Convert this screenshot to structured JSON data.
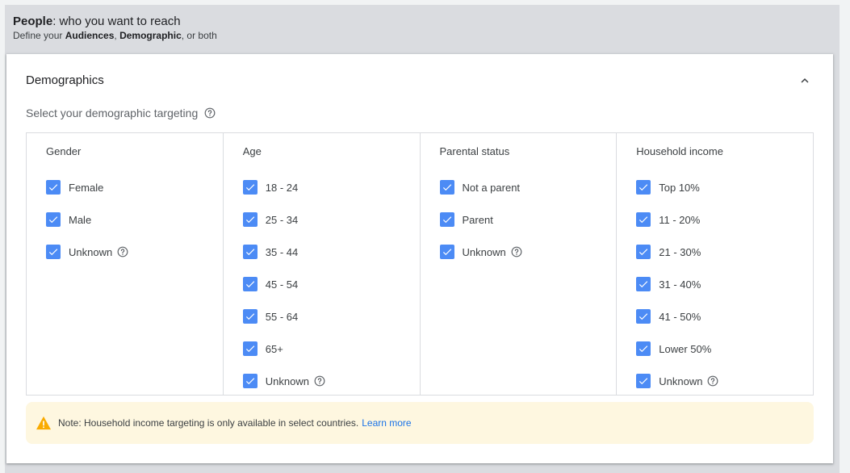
{
  "header": {
    "title_bold": "People",
    "title_rest": ": who you want to reach",
    "subtitle_prefix": "Define your ",
    "subtitle_bold1": "Audiences",
    "subtitle_sep": ", ",
    "subtitle_bold2": "Demographic",
    "subtitle_suffix": ", or both"
  },
  "card": {
    "title": "Demographics",
    "collapse_icon": "chevron-up-icon",
    "instruction": "Select your demographic targeting",
    "help_icon": "help-circle-icon"
  },
  "columns": [
    {
      "header": "Gender",
      "items": [
        {
          "label": "Female",
          "checked": true,
          "help": false
        },
        {
          "label": "Male",
          "checked": true,
          "help": false
        },
        {
          "label": "Unknown",
          "checked": true,
          "help": true
        }
      ]
    },
    {
      "header": "Age",
      "items": [
        {
          "label": "18 - 24",
          "checked": true,
          "help": false
        },
        {
          "label": "25 - 34",
          "checked": true,
          "help": false
        },
        {
          "label": "35 - 44",
          "checked": true,
          "help": false
        },
        {
          "label": "45 - 54",
          "checked": true,
          "help": false
        },
        {
          "label": "55 - 64",
          "checked": true,
          "help": false
        },
        {
          "label": "65+",
          "checked": true,
          "help": false
        },
        {
          "label": "Unknown",
          "checked": true,
          "help": true
        }
      ]
    },
    {
      "header": "Parental status",
      "items": [
        {
          "label": "Not a parent",
          "checked": true,
          "help": false
        },
        {
          "label": "Parent",
          "checked": true,
          "help": false
        },
        {
          "label": "Unknown",
          "checked": true,
          "help": true
        }
      ]
    },
    {
      "header": "Household income",
      "items": [
        {
          "label": "Top 10%",
          "checked": true,
          "help": false
        },
        {
          "label": "11 - 20%",
          "checked": true,
          "help": false
        },
        {
          "label": "21 - 30%",
          "checked": true,
          "help": false
        },
        {
          "label": "31 - 40%",
          "checked": true,
          "help": false
        },
        {
          "label": "41 - 50%",
          "checked": true,
          "help": false
        },
        {
          "label": "Lower 50%",
          "checked": true,
          "help": false
        },
        {
          "label": "Unknown",
          "checked": true,
          "help": true
        }
      ]
    }
  ],
  "note": {
    "icon": "warning-icon",
    "text": "Note: Household income targeting is only available in select countries.",
    "link": "Learn more"
  },
  "colors": {
    "checkbox": "#4c8bf5",
    "link": "#1a73e8",
    "warning": "#f9ab00",
    "note_bg": "#fef7e0"
  }
}
